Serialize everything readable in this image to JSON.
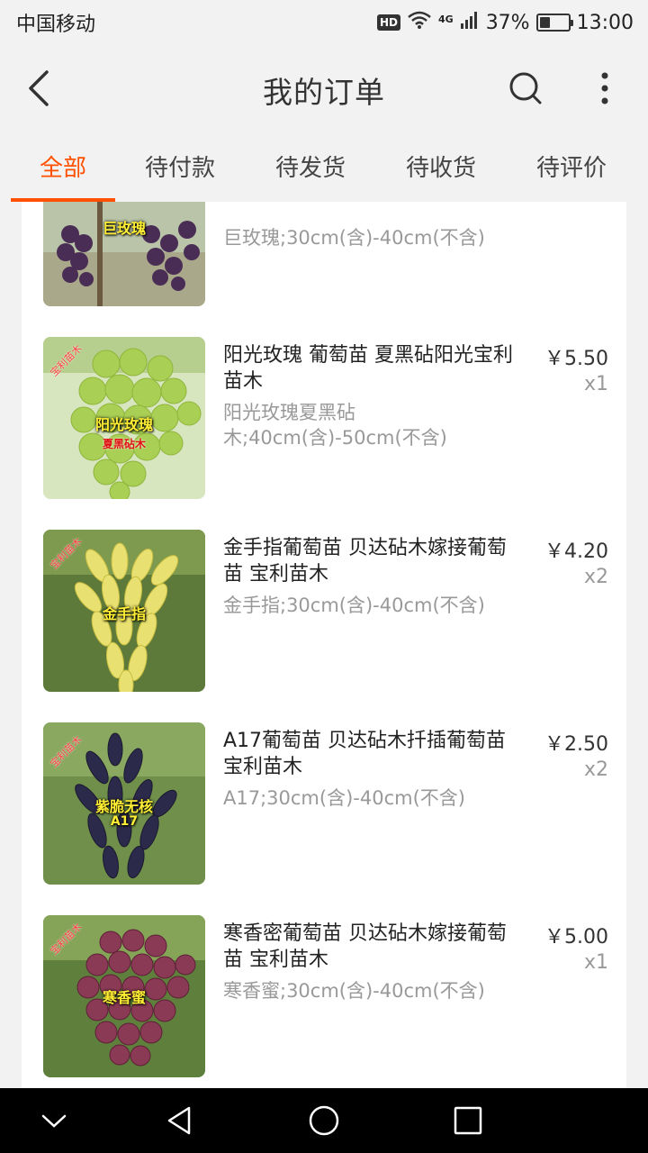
{
  "status_bar": {
    "carrier": "中国移动",
    "hd": "HD",
    "network": "4G",
    "battery": "37%",
    "battery_level": 0.37,
    "time": "13:00"
  },
  "header": {
    "title": "我的订单",
    "back_icon": "back-chevron-icon",
    "search_icon": "search-icon",
    "more_icon": "more-vertical-icon"
  },
  "tabs": [
    {
      "label": "全部",
      "active": true
    },
    {
      "label": "待付款",
      "active": false
    },
    {
      "label": "待发货",
      "active": false
    },
    {
      "label": "待收货",
      "active": false
    },
    {
      "label": "待评价",
      "active": false
    }
  ],
  "items": [
    {
      "title": "",
      "spec": "巨玫瑰;30cm(含)-40cm(不含)",
      "price": "",
      "qty": "",
      "image_label": "巨玫瑰",
      "image_sublabel": "",
      "image_watermark": ""
    },
    {
      "title": "阳光玫瑰 葡萄苗 夏黑砧阳光宝利苗木",
      "spec": "阳光玫瑰夏黑砧木;40cm(含)-50cm(不含)",
      "price": "￥5.50",
      "qty": "x1",
      "image_label": "阳光玫瑰",
      "image_sublabel": "夏黑砧木",
      "image_watermark": "宝利苗木"
    },
    {
      "title": "金手指葡萄苗 贝达砧木嫁接葡萄苗  宝利苗木",
      "spec": "金手指;30cm(含)-40cm(不含)",
      "price": "￥4.20",
      "qty": "x2",
      "image_label": "金手指",
      "image_sublabel": "",
      "image_watermark": "宝利苗木"
    },
    {
      "title": "A17葡萄苗 贝达砧木扦插葡萄苗 宝利苗木",
      "spec": "A17;30cm(含)-40cm(不含)",
      "price": "￥2.50",
      "qty": "x2",
      "image_label": "紫脆无核",
      "image_sublabel": "A17",
      "image_watermark": "宝利苗木"
    },
    {
      "title": "寒香密葡萄苗  贝达砧木嫁接葡萄苗  宝利苗木",
      "spec": "寒香蜜;30cm(含)-40cm(不含)",
      "price": "￥5.00",
      "qty": "x1",
      "image_label": "寒香蜜",
      "image_sublabel": "",
      "image_watermark": "宝利苗木"
    }
  ],
  "nav_bar": {
    "icons": [
      "chevron-down-icon",
      "back-triangle-icon",
      "home-circle-icon",
      "recents-square-icon"
    ]
  },
  "colors": {
    "accent": "#ff5000",
    "background": "#f2f2f2",
    "card": "#ffffff",
    "secondary_text": "#999999"
  }
}
